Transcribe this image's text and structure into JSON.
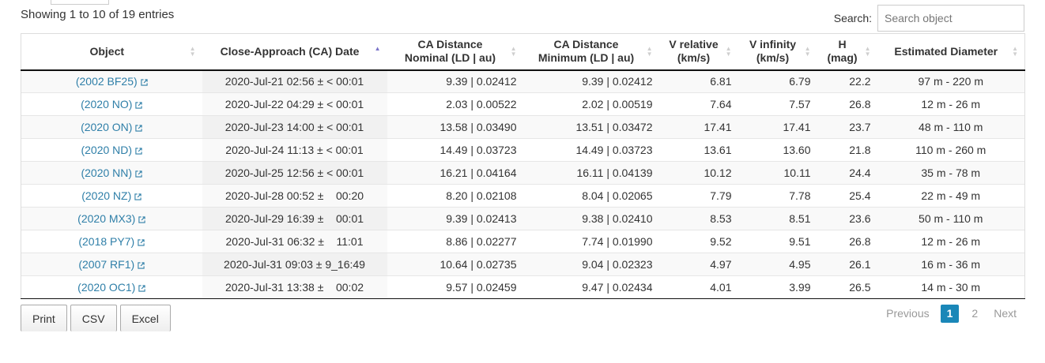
{
  "info": "Showing 1 to 10 of 19 entries",
  "search": {
    "label": "Search:",
    "placeholder": "Search object",
    "value": ""
  },
  "columns": [
    {
      "line1": "Object",
      "line2": ""
    },
    {
      "line1": "Close-Approach (CA) Date",
      "line2": ""
    },
    {
      "line1": "CA Distance",
      "line2": "Nominal (LD | au)"
    },
    {
      "line1": "CA Distance",
      "line2": "Minimum (LD | au)"
    },
    {
      "line1": "V relative",
      "line2": "(km/s)"
    },
    {
      "line1": "V infinity",
      "line2": "(km/s)"
    },
    {
      "line1": "H",
      "line2": "(mag)"
    },
    {
      "line1": "Estimated Diameter",
      "line2": ""
    }
  ],
  "rows": [
    {
      "object": "(2002 BF25)",
      "date": "2020-Jul-21 02:56 ± < 00:01",
      "nominal": "9.39 | 0.02412",
      "minimum": "9.39 | 0.02412",
      "vrel": "6.81",
      "vinf": "6.79",
      "h": "22.2",
      "diameter": "97 m - 220 m"
    },
    {
      "object": "(2020 NO)",
      "date": "2020-Jul-22 04:29 ± < 00:01",
      "nominal": "2.03 | 0.00522",
      "minimum": "2.02 | 0.00519",
      "vrel": "7.64",
      "vinf": "7.57",
      "h": "26.8",
      "diameter": "12 m - 26 m"
    },
    {
      "object": "(2020 ON)",
      "date": "2020-Jul-23 14:00 ± < 00:01",
      "nominal": "13.58 | 0.03490",
      "minimum": "13.51 | 0.03472",
      "vrel": "17.41",
      "vinf": "17.41",
      "h": "23.7",
      "diameter": "48 m - 110 m"
    },
    {
      "object": "(2020 ND)",
      "date": "2020-Jul-24 11:13 ± < 00:01",
      "nominal": "14.49 | 0.03723",
      "minimum": "14.49 | 0.03723",
      "vrel": "13.61",
      "vinf": "13.60",
      "h": "21.8",
      "diameter": "110 m - 260 m"
    },
    {
      "object": "(2020 NN)",
      "date": "2020-Jul-25 12:56 ± < 00:01",
      "nominal": "16.21 | 0.04164",
      "minimum": "16.11 | 0.04139",
      "vrel": "10.12",
      "vinf": "10.11",
      "h": "24.4",
      "diameter": "35 m - 78 m"
    },
    {
      "object": "(2020 NZ)",
      "date": "2020-Jul-28 00:52 ±    00:20",
      "nominal": "8.20 | 0.02108",
      "minimum": "8.04 | 0.02065",
      "vrel": "7.79",
      "vinf": "7.78",
      "h": "25.4",
      "diameter": "22 m - 49 m"
    },
    {
      "object": "(2020 MX3)",
      "date": "2020-Jul-29 16:39 ±    00:01",
      "nominal": "9.39 | 0.02413",
      "minimum": "9.38 | 0.02410",
      "vrel": "8.53",
      "vinf": "8.51",
      "h": "23.6",
      "diameter": "50 m - 110 m"
    },
    {
      "object": "(2018 PY7)",
      "date": "2020-Jul-31 06:32 ±    11:01",
      "nominal": "8.86 | 0.02277",
      "minimum": "7.74 | 0.01990",
      "vrel": "9.52",
      "vinf": "9.51",
      "h": "26.8",
      "diameter": "12 m - 26 m"
    },
    {
      "object": "(2007 RF1)",
      "date": "2020-Jul-31 09:03 ± 9_16:49",
      "nominal": "10.64 | 0.02735",
      "minimum": "9.04 | 0.02323",
      "vrel": "4.97",
      "vinf": "4.95",
      "h": "26.1",
      "diameter": "16 m - 36 m"
    },
    {
      "object": "(2020 OC1)",
      "date": "2020-Jul-31 13:38 ±    00:02",
      "nominal": "9.57 | 0.02459",
      "minimum": "9.47 | 0.02434",
      "vrel": "4.01",
      "vinf": "3.99",
      "h": "26.5",
      "diameter": "14 m - 30 m"
    }
  ],
  "buttons": [
    "Print",
    "CSV",
    "Excel"
  ],
  "pagination": {
    "previous": "Previous",
    "pages": [
      "1",
      "2"
    ],
    "active": "1",
    "next": "Next"
  },
  "colors": {
    "link": "#2f7fa8",
    "active_page": "#1a87b8",
    "sort_asc": "#7b74c9"
  },
  "icons": {
    "external_link": "external-link-icon",
    "sort": "sort-icon"
  }
}
